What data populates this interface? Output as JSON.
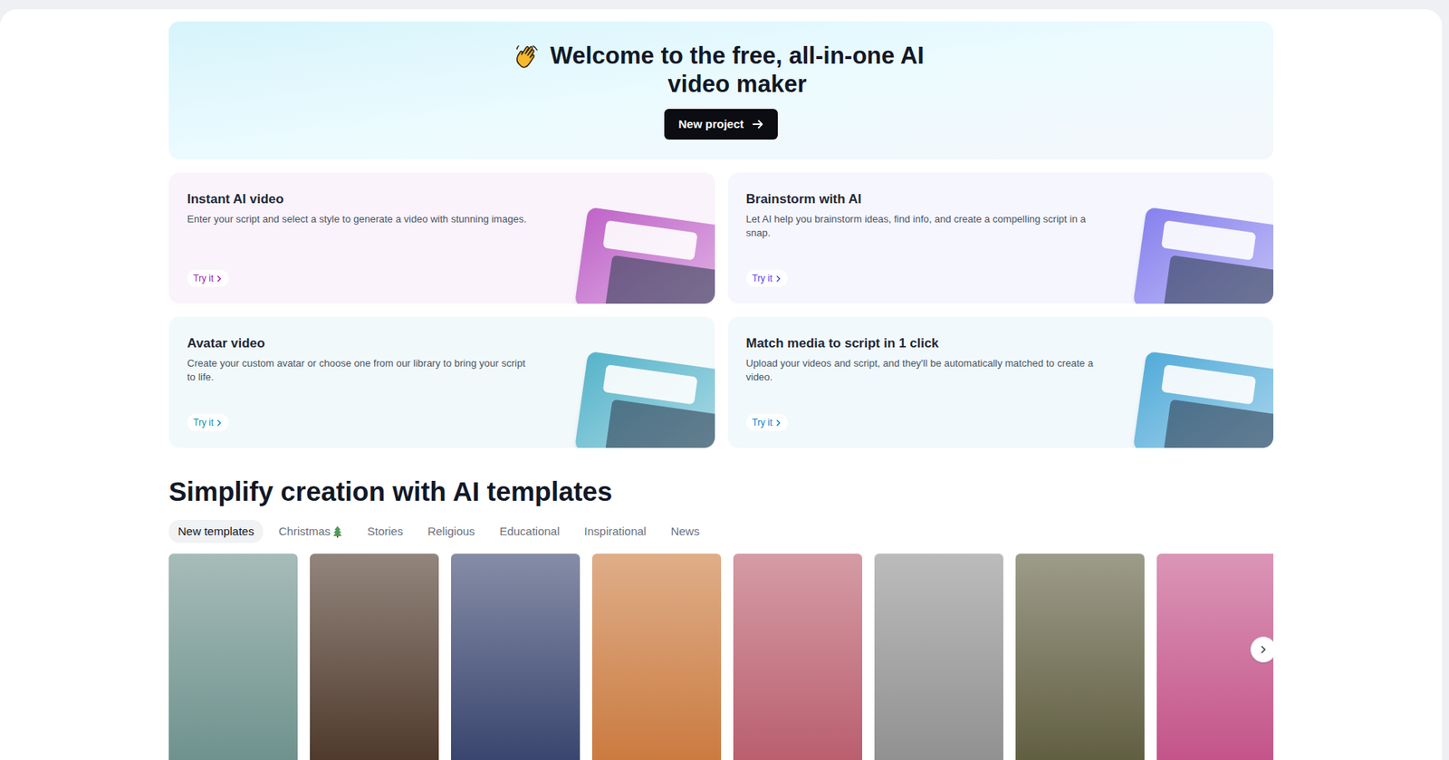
{
  "hero": {
    "title": "Welcome to the free, all-in-one AI video maker",
    "button": "New project"
  },
  "features": [
    {
      "title": "Instant AI video",
      "description": "Enter your script and select a style to generate a video with stunning images.",
      "action": "Try it",
      "color": "#a21caf"
    },
    {
      "title": "Brainstorm with AI",
      "description": "Let AI help you brainstorm ideas, find info, and create a compelling script in a snap.",
      "action": "Try it",
      "color": "#4f46e5"
    },
    {
      "title": "Avatar video",
      "description": "Create your custom avatar or choose one from our library to bring your script to life.",
      "action": "Try it",
      "color": "#0891b2"
    },
    {
      "title": "Match media to script in 1 click",
      "description": "Upload your videos and script, and they'll be automatically matched to create a video.",
      "action": "Try it",
      "color": "#0284c7"
    }
  ],
  "templates": {
    "heading": "Simplify creation with AI templates",
    "tabs": [
      {
        "label": "New templates",
        "selected": true
      },
      {
        "label": "Christmas",
        "selected": false
      },
      {
        "label": "Stories",
        "selected": false
      },
      {
        "label": "Religious",
        "selected": false
      },
      {
        "label": "Educational",
        "selected": false
      },
      {
        "label": "Inspirational",
        "selected": false
      },
      {
        "label": "News",
        "selected": false
      }
    ],
    "cards": [
      {
        "color": "#6b8f8a"
      },
      {
        "color": "#4a3426"
      },
      {
        "color": "#34406b"
      },
      {
        "color": "#c9773a"
      },
      {
        "color": "#b85a6a"
      },
      {
        "color": "#8e8e8e"
      },
      {
        "color": "#5c5a3c"
      },
      {
        "color": "#c24f86"
      }
    ]
  }
}
